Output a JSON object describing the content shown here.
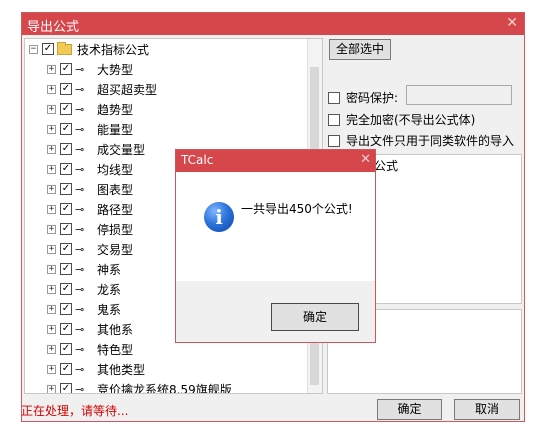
{
  "window": {
    "title": "导出公式",
    "close_glyph": "✕"
  },
  "tree": {
    "root_label": "技术指标公式",
    "items": [
      {
        "label": "大势型"
      },
      {
        "label": "超买超卖型"
      },
      {
        "label": "趋势型"
      },
      {
        "label": "能量型"
      },
      {
        "label": "成交量型"
      },
      {
        "label": "均线型"
      },
      {
        "label": "图表型"
      },
      {
        "label": "路径型"
      },
      {
        "label": "停损型"
      },
      {
        "label": "交易型"
      },
      {
        "label": "神系"
      },
      {
        "label": "龙系"
      },
      {
        "label": "鬼系"
      },
      {
        "label": "其他系"
      },
      {
        "label": "特色型"
      },
      {
        "label": "其他类型"
      },
      {
        "label": "竞价擒龙系统8.59旗舰版"
      }
    ]
  },
  "right_panel": {
    "select_all_label": "全部选中",
    "password_label": "密码保护:",
    "encrypt_label": "完全加密(不导出公式体)",
    "same_software_label": "导出文件只用于同类软件的导入",
    "partial_label": "公式"
  },
  "footer": {
    "status_text": "正在处理，请等待...",
    "ok_label": "确定",
    "cancel_label": "取消"
  },
  "dialog": {
    "title": "TCalc",
    "close_glyph": "✕",
    "icon_glyph": "i",
    "message": "一共导出450个公式!",
    "ok_label": "确定"
  },
  "colors": {
    "title_bar": "#d6474c",
    "status_text": "#d40000"
  }
}
